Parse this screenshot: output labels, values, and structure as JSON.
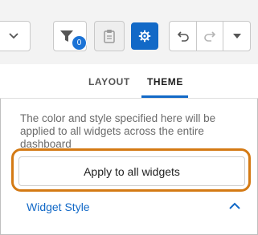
{
  "toolbar": {
    "filter_badge": "0",
    "icons": {
      "dropdown": "chevron-down-icon",
      "filter": "filter-icon",
      "clipboard": "clipboard-icon",
      "settings": "gear-icon",
      "undo": "undo-icon",
      "redo": "redo-icon",
      "more": "caret-down-icon"
    }
  },
  "tabs": [
    {
      "label": "LAYOUT",
      "active": false
    },
    {
      "label": "THEME",
      "active": true
    }
  ],
  "theme_panel": {
    "description": "The color and style specified here will be applied to all widgets across the entire dashboard",
    "apply_button_label": "Apply to all widgets",
    "section_title": "Widget Style"
  },
  "colors": {
    "accent": "#1269c7",
    "highlight": "#d47a14",
    "toolbar_bg": "#f3f3f3"
  }
}
